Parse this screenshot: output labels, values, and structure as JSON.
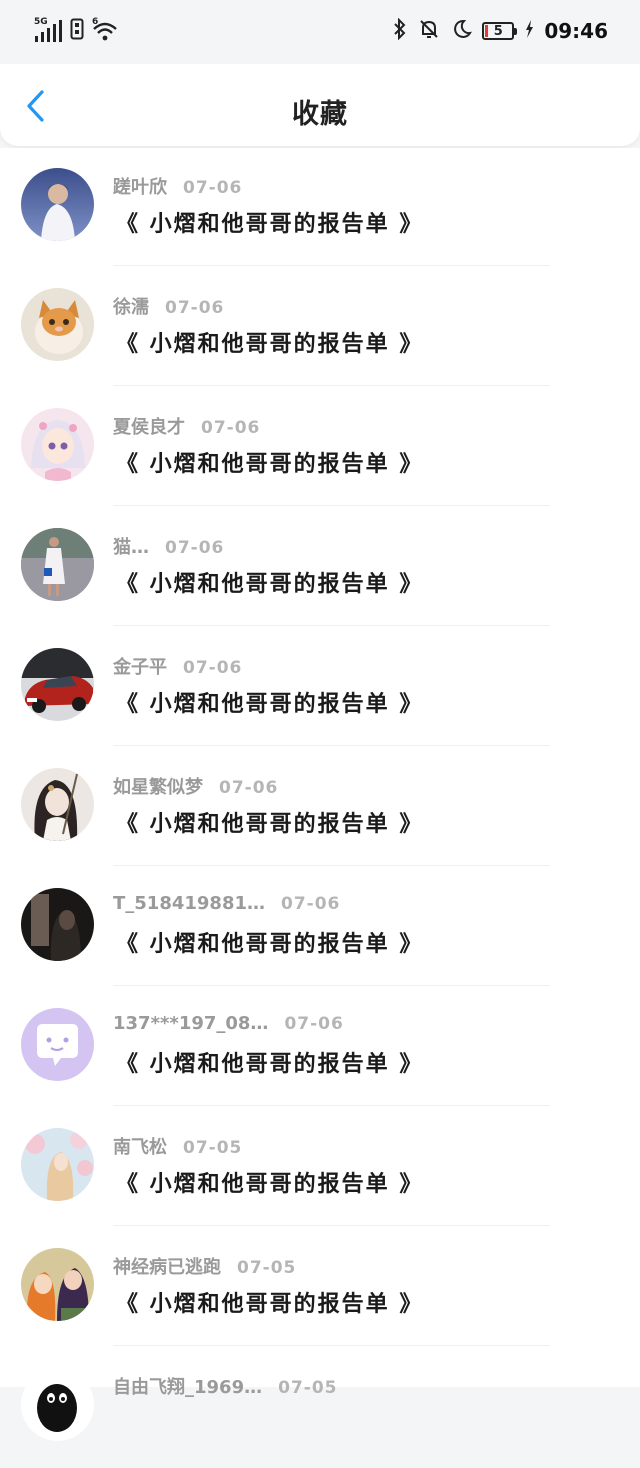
{
  "status_bar": {
    "network": "5G",
    "wifi_badge": "6",
    "battery": "5",
    "time": "09:46"
  },
  "header": {
    "title": "收藏"
  },
  "items": [
    {
      "name": "蹉叶欣",
      "date": "07-06",
      "title": "《 小熠和他哥哥的报告单 》"
    },
    {
      "name": "徐濡",
      "date": "07-06",
      "title": "《 小熠和他哥哥的报告单 》"
    },
    {
      "name": "夏侯良才",
      "date": "07-06",
      "title": "《 小熠和他哥哥的报告单 》"
    },
    {
      "name": "猫…",
      "date": "07-06",
      "title": "《 小熠和他哥哥的报告单 》"
    },
    {
      "name": "金子平",
      "date": "07-06",
      "title": "《 小熠和他哥哥的报告单 》"
    },
    {
      "name": "如星繁似梦",
      "date": "07-06",
      "title": "《 小熠和他哥哥的报告单 》"
    },
    {
      "name": "T_518419881…",
      "date": "07-06",
      "title": "《 小熠和他哥哥的报告单 》"
    },
    {
      "name": "137***197_08…",
      "date": "07-06",
      "title": "《 小熠和他哥哥的报告单 》"
    },
    {
      "name": "南飞松",
      "date": "07-05",
      "title": "《 小熠和他哥哥的报告单 》"
    },
    {
      "name": "神经病已逃跑",
      "date": "07-05",
      "title": "《 小熠和他哥哥的报告单 》"
    },
    {
      "name": "自由飞翔_1969…",
      "date": "07-05",
      "title": ""
    }
  ],
  "colors": {
    "back_arrow": "#2196f3",
    "title": "#222222",
    "name": "#9a9a9a",
    "date": "#b5b5b5"
  }
}
